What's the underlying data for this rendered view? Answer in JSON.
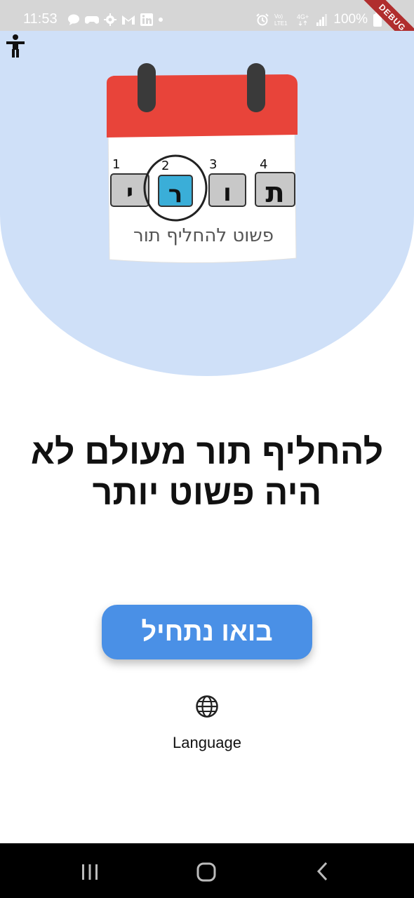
{
  "status_bar": {
    "time": "11:53",
    "network": "Vo) LTE1",
    "signal": "4G+",
    "battery": "100%",
    "icons_left": [
      "chat-icon",
      "games-icon",
      "settings-icon",
      "gmail-icon",
      "linkedin-icon",
      "dot-icon"
    ],
    "icons_right": [
      "alarm-icon",
      "volte-icon",
      "4g-icon",
      "signal-icon",
      "battery-icon"
    ]
  },
  "debug_banner": {
    "label": "DEBUG"
  },
  "logo": {
    "letters": [
      "ת",
      "ו",
      "ר",
      "י"
    ],
    "numbers": [
      "4",
      "3",
      "2",
      "1"
    ],
    "tagline": "פשוט להחליף תור"
  },
  "headline": {
    "line1": "להחליף תור מעולם לא",
    "line2": "היה פשוט יותר"
  },
  "start_button": {
    "label": "בואו נתחיל"
  },
  "language_button": {
    "label": "Language",
    "icon": "globe-icon"
  },
  "colors": {
    "hero_bg": "#cfe0f8",
    "primary": "#4a90e6",
    "calendar_top": "#e8443a",
    "tile_highlight": "#3aaed8"
  }
}
